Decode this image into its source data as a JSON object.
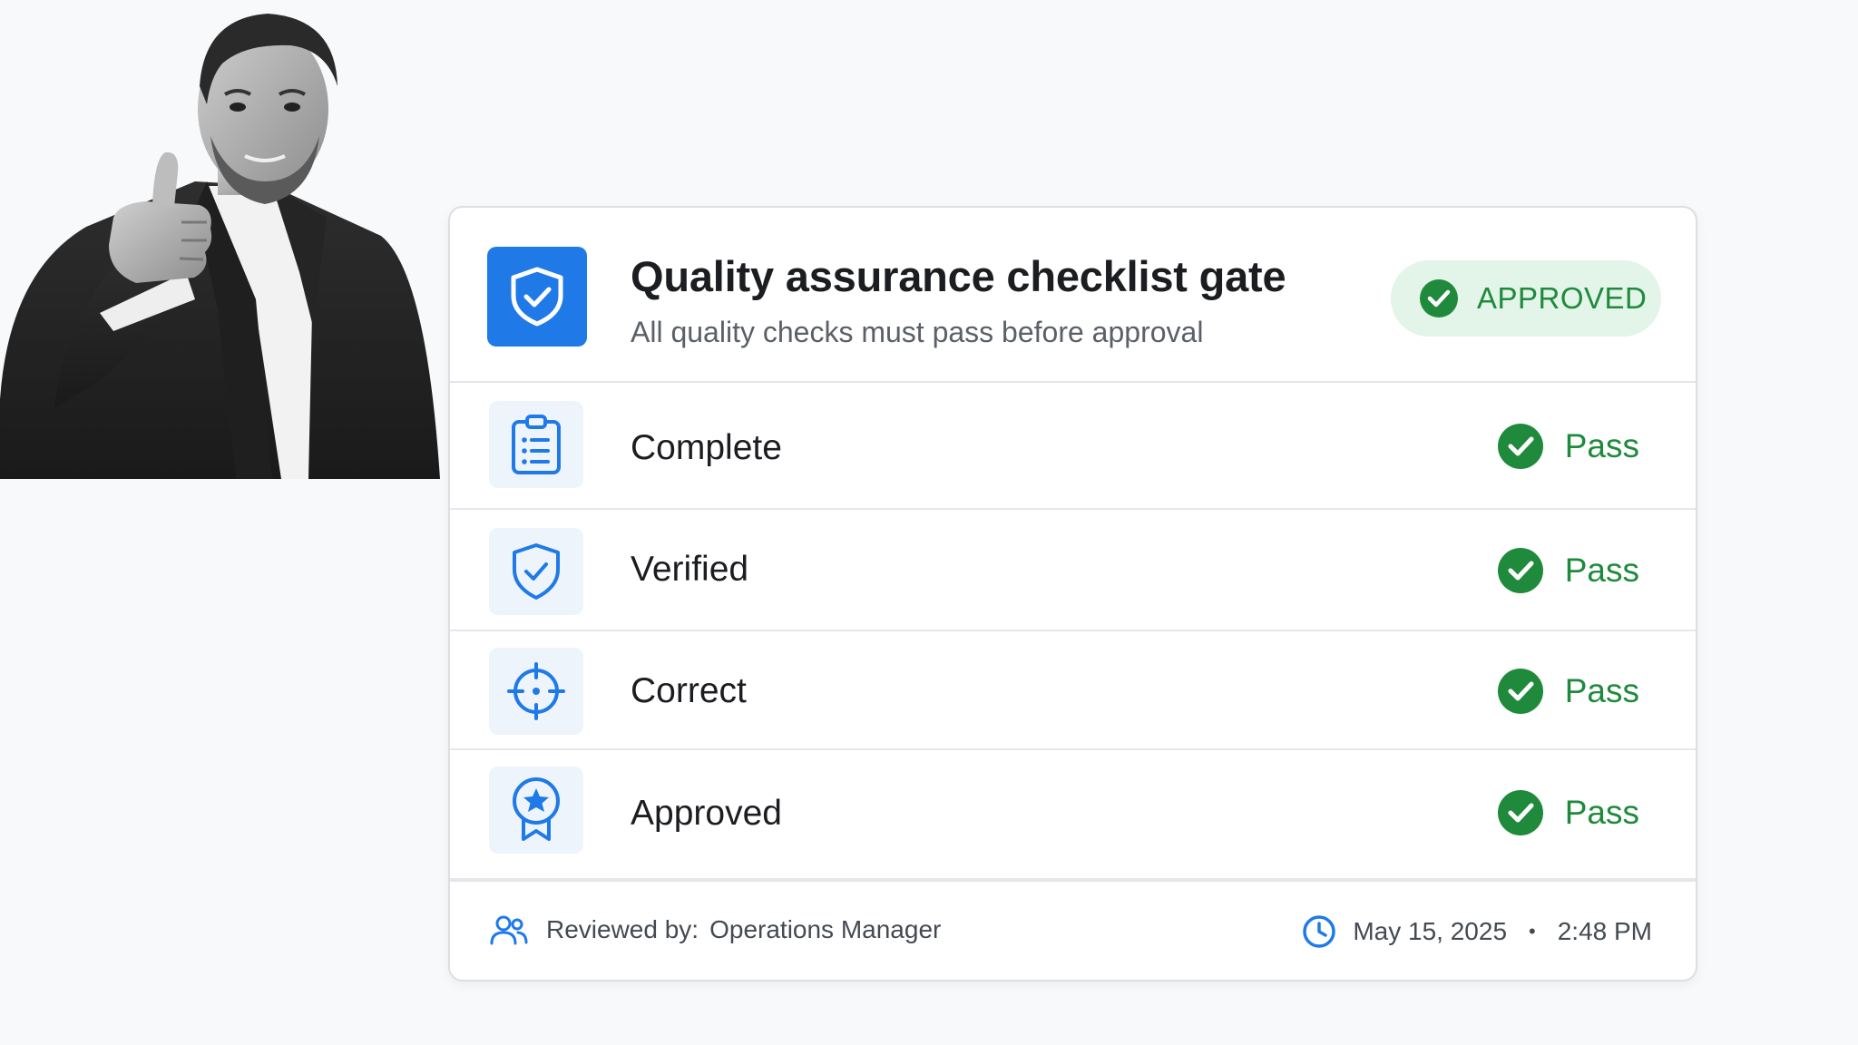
{
  "card": {
    "title": "Quality assurance checklist gate",
    "subtitle": "All quality checks must pass before approval",
    "status_badge": "APPROVED"
  },
  "checks": [
    {
      "label": "Complete",
      "status": "Pass",
      "icon": "clipboard-list-icon"
    },
    {
      "label": "Verified",
      "status": "Pass",
      "icon": "shield-check-icon"
    },
    {
      "label": "Correct",
      "status": "Pass",
      "icon": "crosshair-icon"
    },
    {
      "label": "Approved",
      "status": "Pass",
      "icon": "award-badge-icon"
    }
  ],
  "footer": {
    "reviewed_by_label": "Reviewed by:",
    "reviewer": "Operations Manager",
    "date": "May 15, 2025",
    "separator": "•",
    "time": "2:48 PM"
  },
  "colors": {
    "accent": "#1f7ae8",
    "pass_green": "#1f8a3b",
    "badge_bg": "#e3f4e9",
    "icon_tile_bg": "#eef4fb"
  }
}
